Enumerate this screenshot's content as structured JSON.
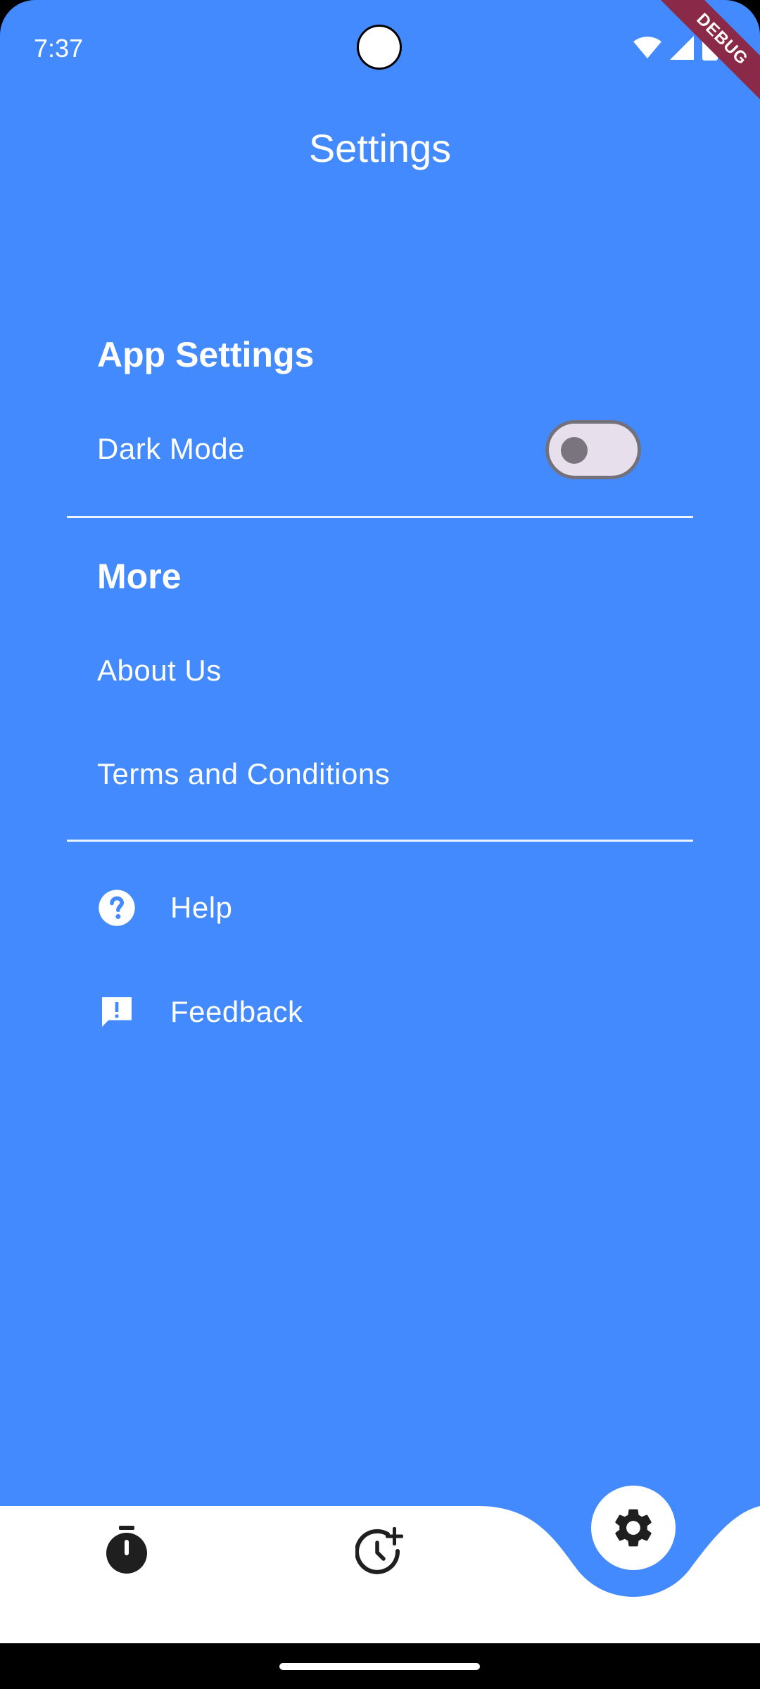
{
  "status_bar": {
    "time": "7:37",
    "icons": [
      "wifi-icon",
      "signal-icon",
      "battery-icon"
    ],
    "debug_banner": "DEBUG"
  },
  "app_bar": {
    "title": "Settings"
  },
  "sections": {
    "app_settings": {
      "header": "App Settings",
      "dark_mode": {
        "label": "Dark Mode",
        "enabled": false
      }
    },
    "more": {
      "header": "More",
      "items": [
        "About Us",
        "Terms and Conditions"
      ]
    },
    "support": {
      "items": [
        {
          "label": "Help",
          "icon": "help-circle-icon"
        },
        {
          "label": "Feedback",
          "icon": "feedback-icon"
        }
      ]
    }
  },
  "bottom_nav": {
    "items": [
      {
        "icon": "timer-icon",
        "selected": false
      },
      {
        "icon": "alarm-add-icon",
        "selected": false
      },
      {
        "icon": "settings-gear-icon",
        "selected": true
      }
    ]
  },
  "colors": {
    "background": "#448aff",
    "surface": "#ffffff",
    "switch_track": "#e7e0ec",
    "switch_outline": "#72717c",
    "debug_banner": "#8b2a48"
  }
}
